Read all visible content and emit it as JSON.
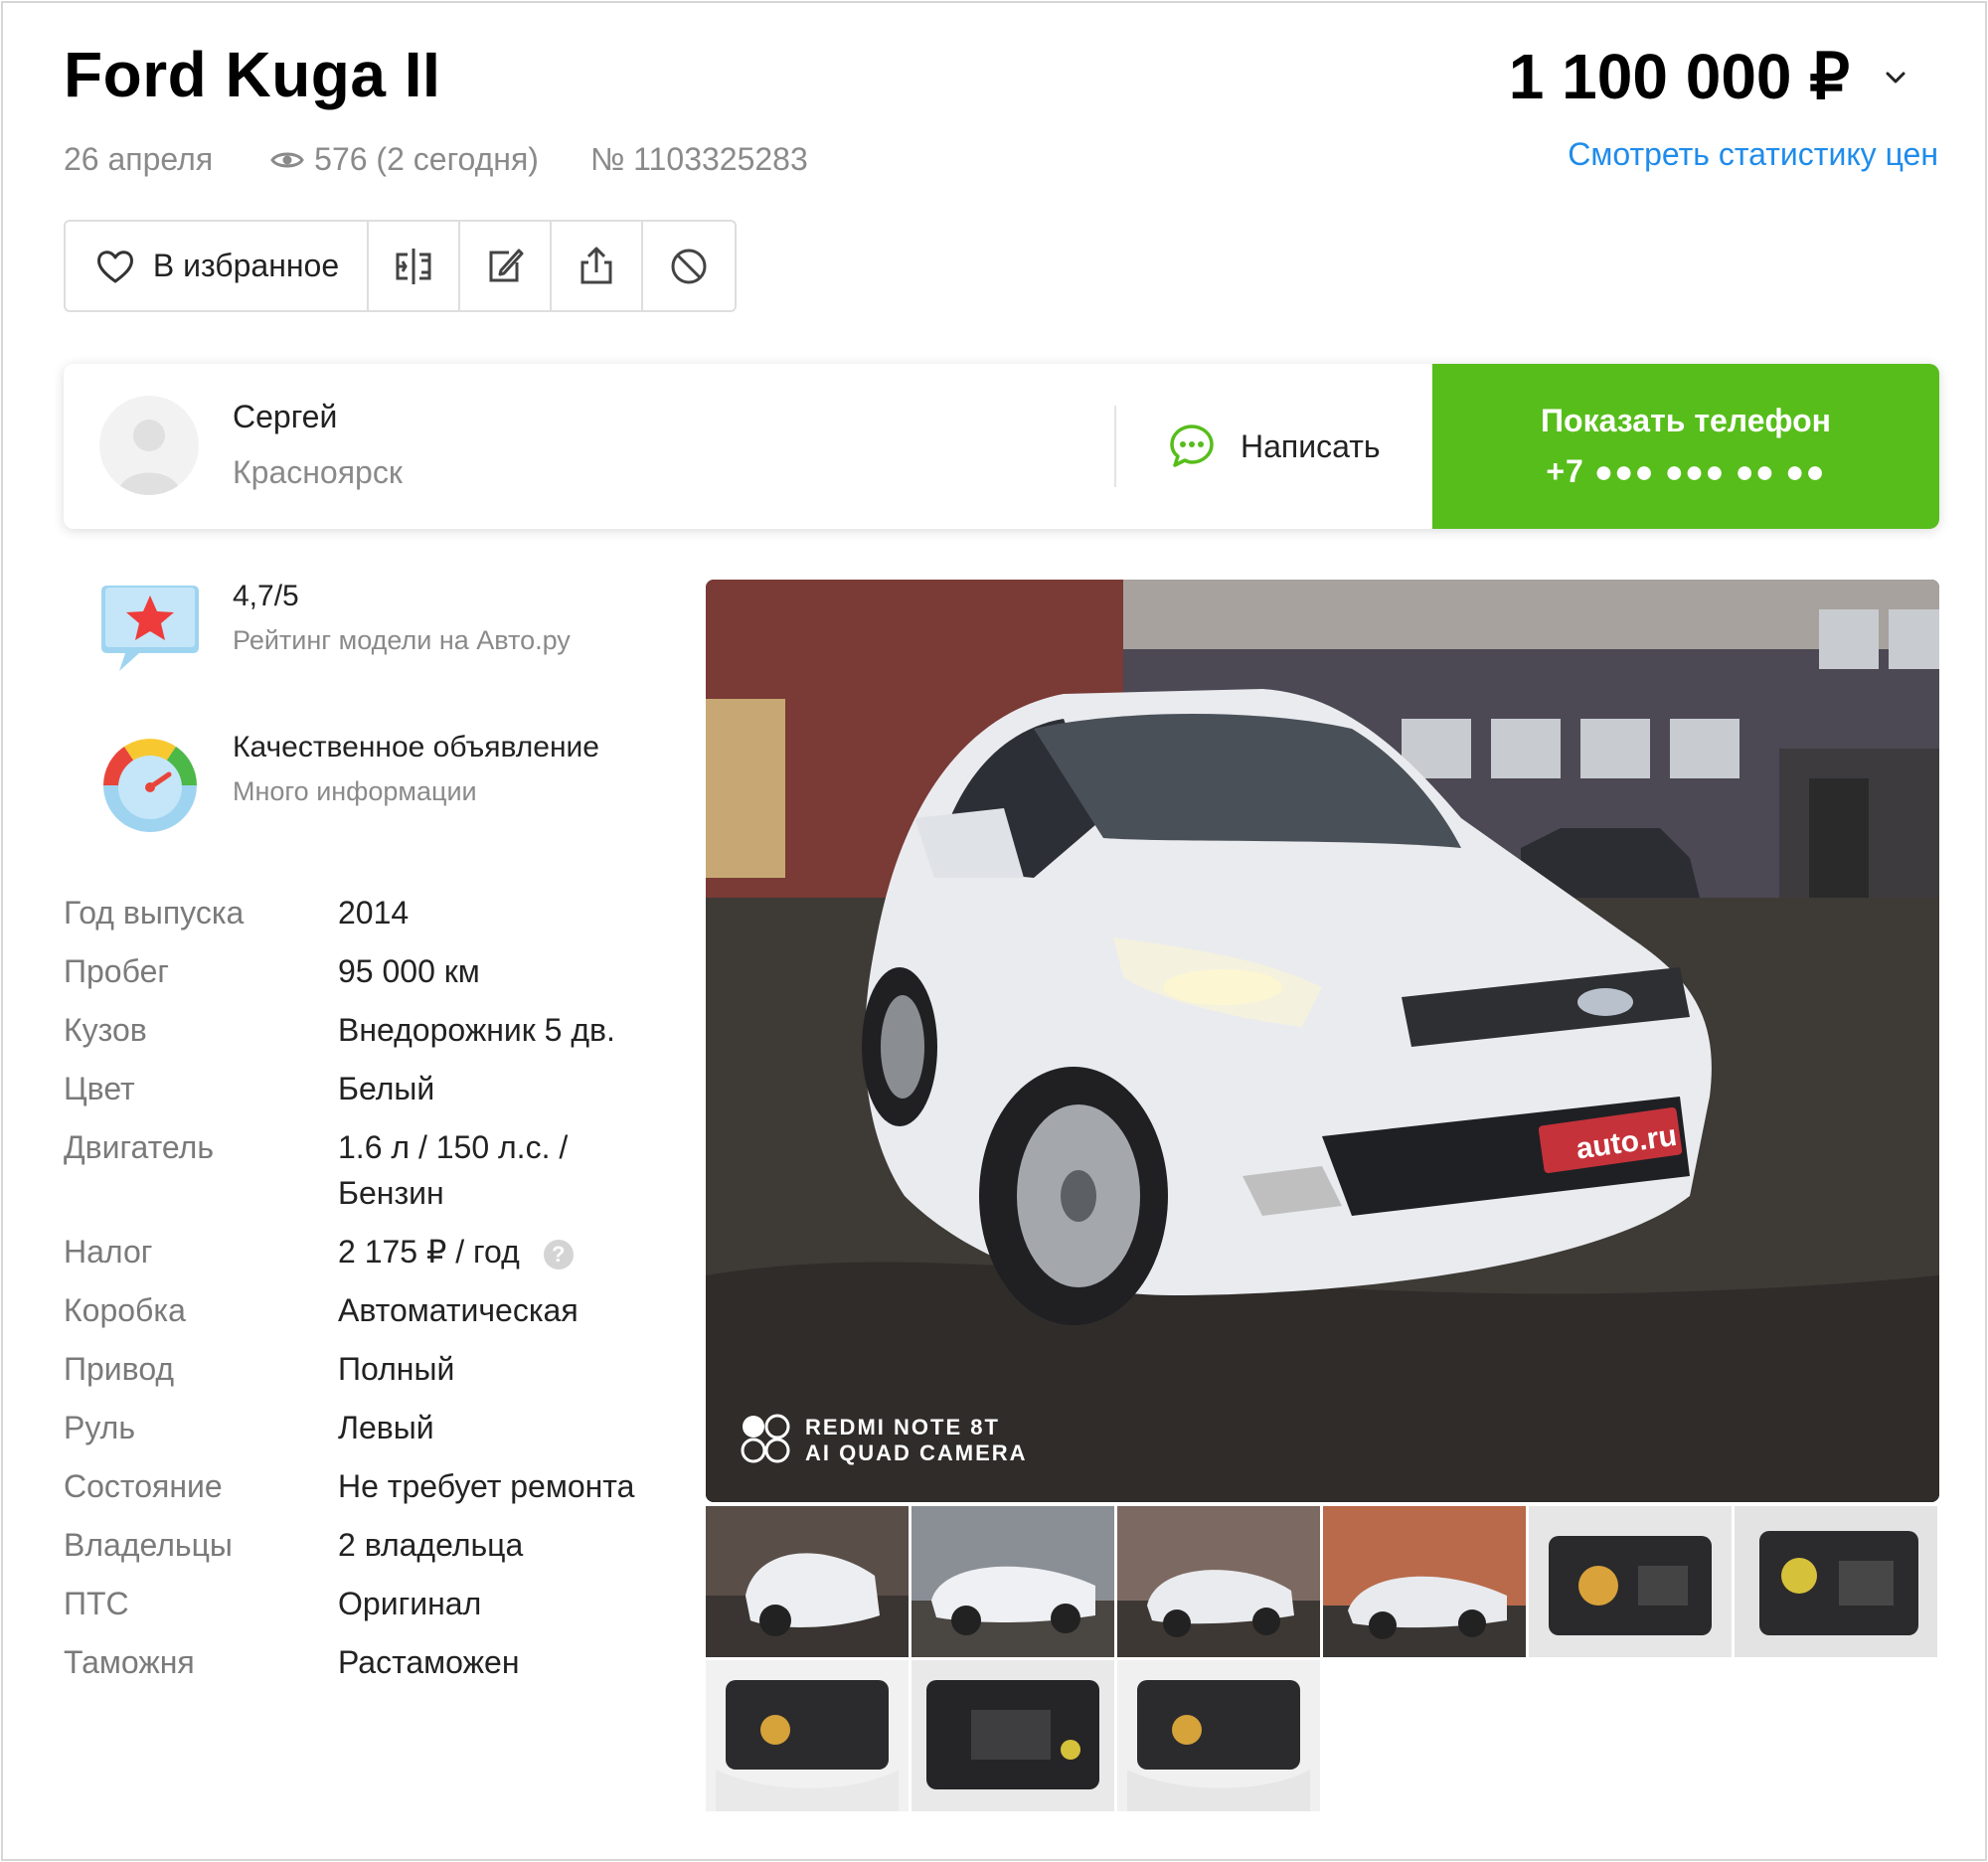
{
  "listing": {
    "title": "Ford Kuga II",
    "price": "1 100 000 ₽",
    "stats_link": "Смотреть статистику цен",
    "date": "26 апреля",
    "views": "576 (2 сегодня)",
    "number": "№ 1103325283"
  },
  "actions": {
    "favorite_label": "В избранное",
    "icons": [
      "compare-icon",
      "edit-note-icon",
      "share-icon",
      "block-icon"
    ]
  },
  "seller": {
    "name": "Сергей",
    "city": "Красноярск",
    "write_label": "Написать",
    "show_phone_label": "Показать телефон",
    "phone_masked": "+7 ●●● ●●● ●● ●●"
  },
  "badges": {
    "rating_value": "4,7/5",
    "rating_caption": "Рейтинг модели на Авто.ру",
    "quality_title": "Качественное объявление",
    "quality_caption": "Много информации"
  },
  "specs": [
    {
      "key": "Год выпуска",
      "value": "2014"
    },
    {
      "key": "Пробег",
      "value": "95 000 км"
    },
    {
      "key": "Кузов",
      "value": "Внедорожник 5 дв."
    },
    {
      "key": "Цвет",
      "value": "Белый"
    },
    {
      "key": "Двигатель",
      "value": "1.6 л / 150 л.с. / Бензин"
    },
    {
      "key": "Налог",
      "value": "2 175 ₽ / год"
    },
    {
      "key": "Коробка",
      "value": "Автоматическая"
    },
    {
      "key": "Привод",
      "value": "Полный"
    },
    {
      "key": "Руль",
      "value": "Левый"
    },
    {
      "key": "Состояние",
      "value": "Не требует ремонта"
    },
    {
      "key": "Владельцы",
      "value": "2 владельца"
    },
    {
      "key": "ПТС",
      "value": "Оригинал"
    },
    {
      "key": "Таможня",
      "value": "Растаможен"
    }
  ],
  "photo": {
    "watermark_line1": "REDMI NOTE 8T",
    "watermark_line2": "AI QUAD CAMERA",
    "plate_text": "auto.ru"
  },
  "thumbnails_count": 9,
  "colors": {
    "accent_green": "#57bd1b",
    "link_blue": "#1f8ceb",
    "muted_text": "#8a8a8a"
  }
}
